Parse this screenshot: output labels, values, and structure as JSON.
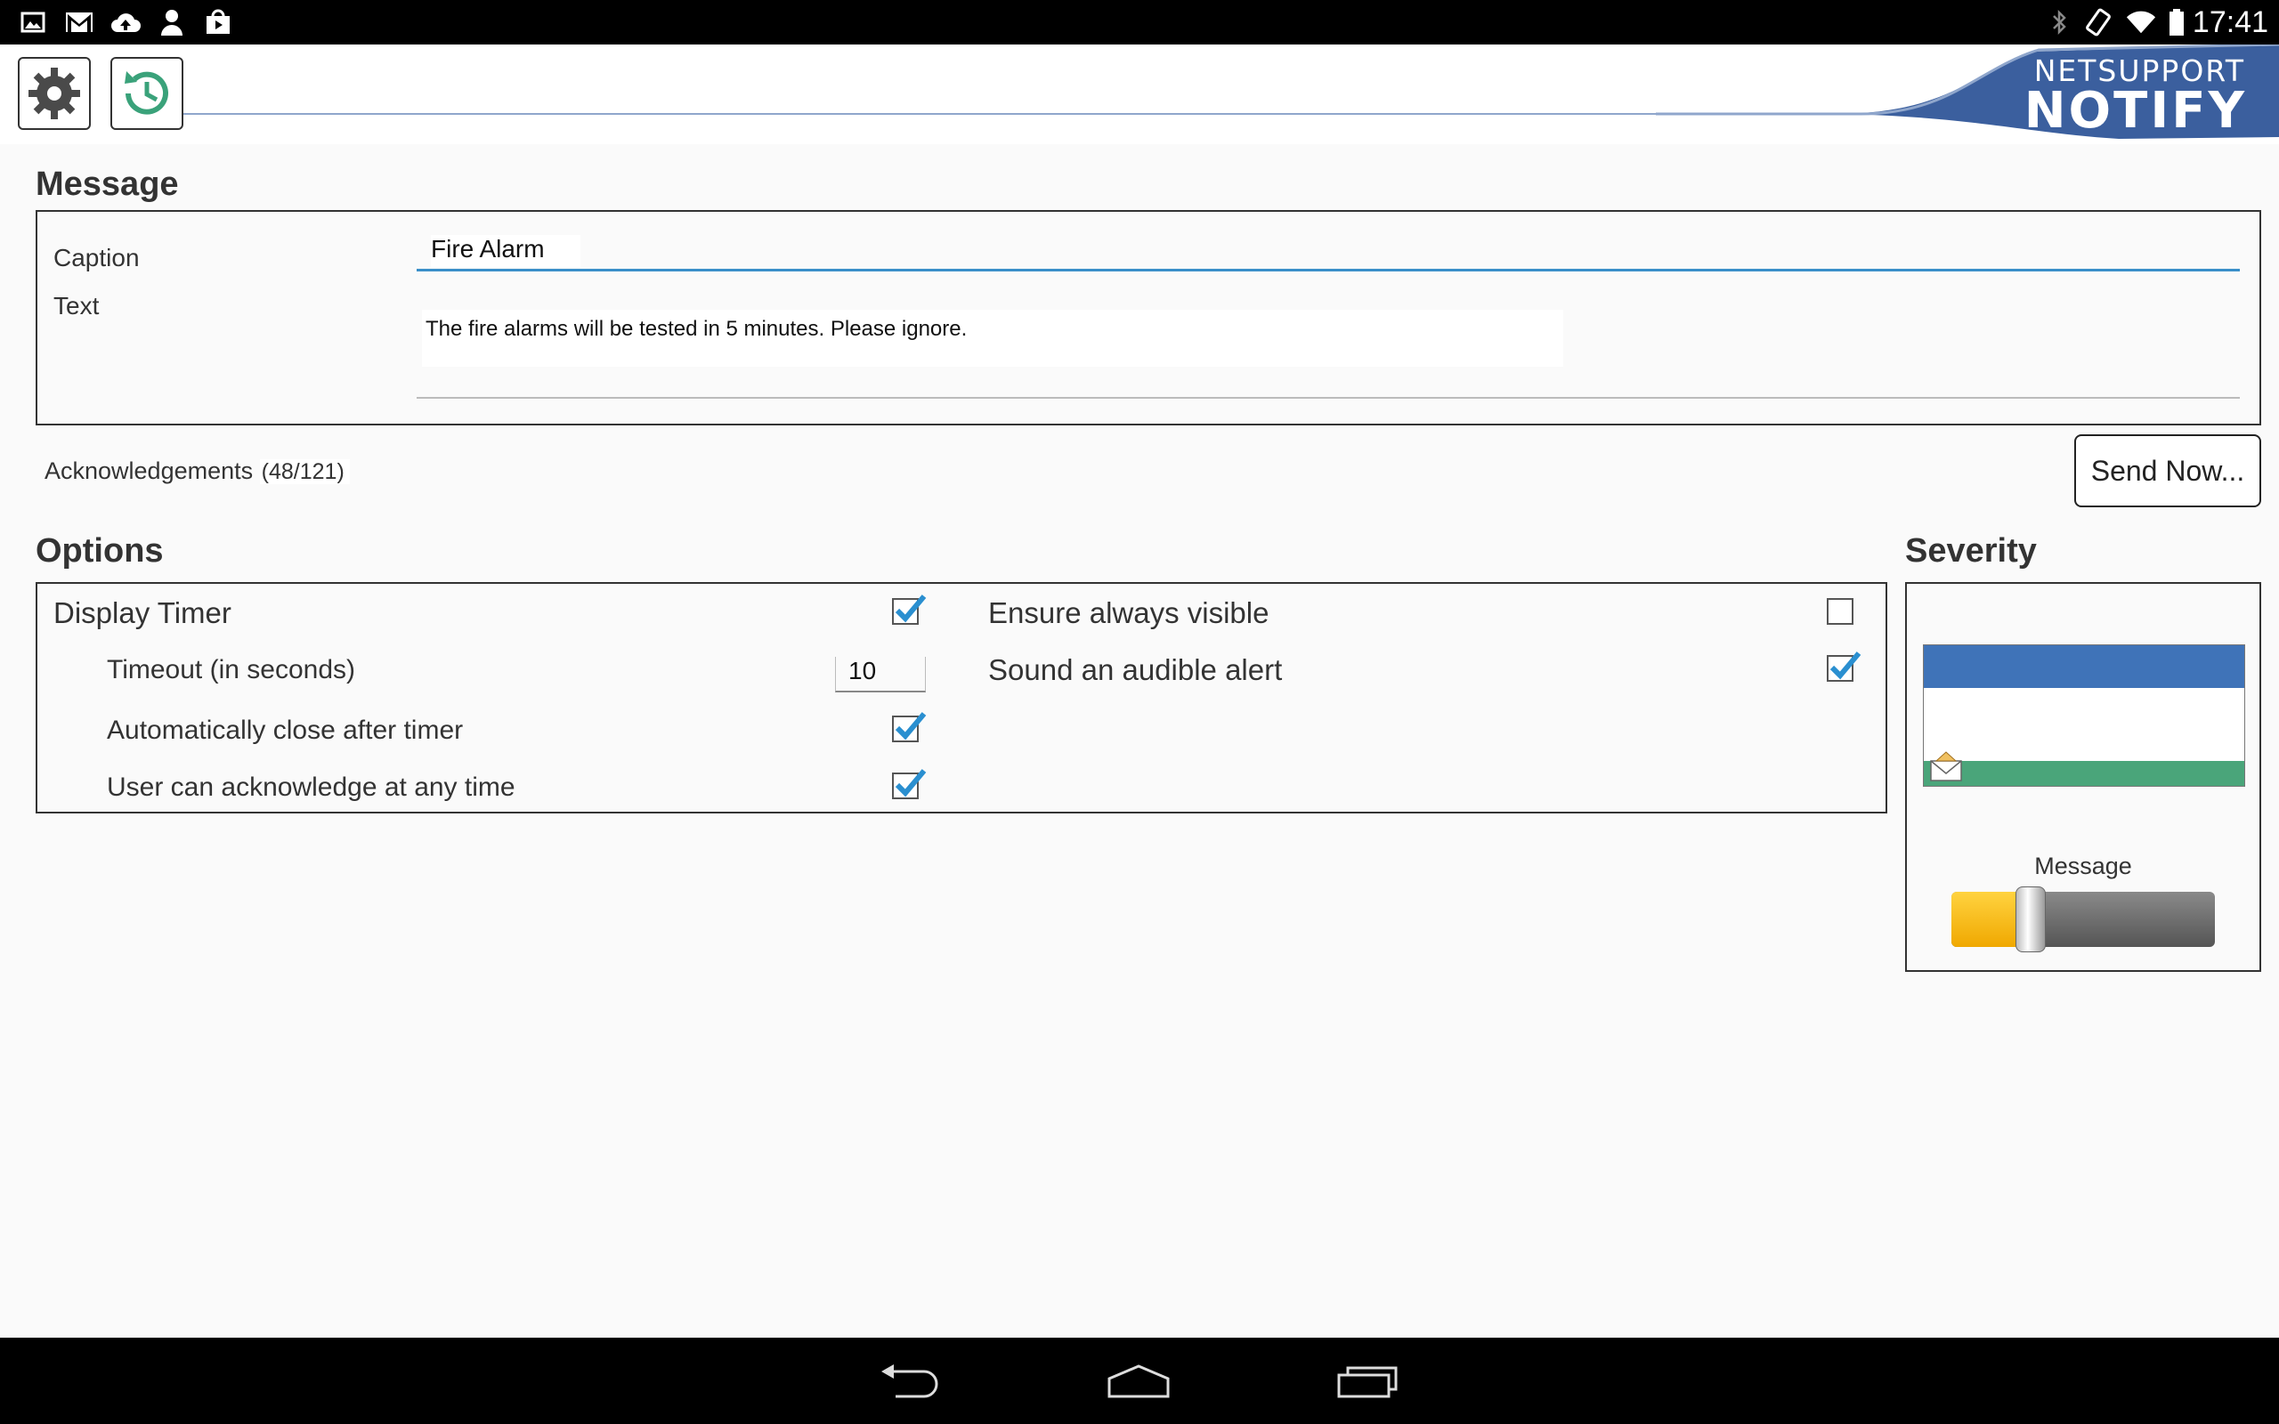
{
  "status_bar": {
    "time": "17:41",
    "left_icons": [
      "image-icon",
      "gmail-icon",
      "cloud-upload-icon",
      "person-icon",
      "shop-bag-icon"
    ],
    "right_icons": [
      "bluetooth-icon",
      "rotate-icon",
      "wifi-icon",
      "battery-icon"
    ]
  },
  "header": {
    "brand_top": "NETSUPPORT",
    "brand_bottom": "NOTIFY",
    "tools": [
      "settings-icon",
      "history-icon"
    ],
    "brand_color": "#3b5f9e"
  },
  "message": {
    "section_title": "Message",
    "caption_label": "Caption",
    "caption_value": "Fire Alarm",
    "text_label": "Text",
    "text_value": "The fire alarms will be tested in 5 minutes. Please ignore."
  },
  "acknowledgements": {
    "label": "Acknowledgements",
    "count": "(48/121)"
  },
  "send_button": "Send Now...",
  "options": {
    "section_title": "Options",
    "left": [
      {
        "label": "Display Timer",
        "checked": true
      },
      {
        "label": "Timeout (in seconds)",
        "value": "10"
      },
      {
        "label": "Automatically close after timer",
        "checked": true
      },
      {
        "label": "User can acknowledge at any time",
        "checked": true
      }
    ],
    "right": [
      {
        "label": "Ensure always visible",
        "checked": false
      },
      {
        "label": "Sound an audible alert",
        "checked": true
      }
    ]
  },
  "severity": {
    "section_title": "Severity",
    "level_label": "Message",
    "slider_level": 0.3,
    "colors": {
      "top": "#3f73b8",
      "bottom": "#4aa57a",
      "slider_fill": "#f5b800"
    }
  },
  "nav_bar": [
    "back-icon",
    "home-icon",
    "recents-icon"
  ]
}
